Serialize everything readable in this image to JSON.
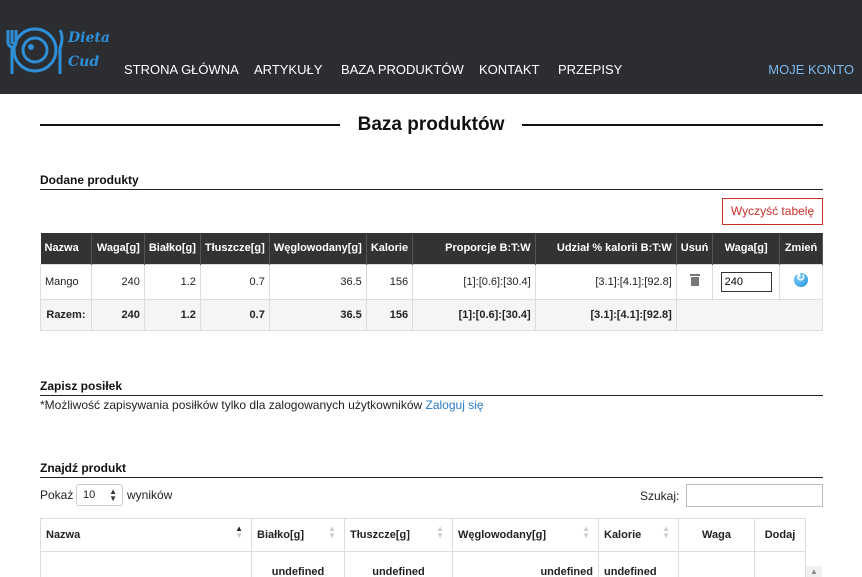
{
  "brand": {
    "line1": "Dieta",
    "line2": "Cud"
  },
  "nav": {
    "items": [
      "STRONA GŁÓWNA",
      "ARTYKUŁY",
      "BAZA PRODUKTÓW",
      "KONTAKT",
      "PRZEPISY"
    ],
    "account": "MOJE KONTO"
  },
  "page_title": "Baza produktów",
  "added": {
    "heading": "Dodane produkty",
    "clear_button": "Wyczyść tabelę",
    "columns": [
      "Nazwa",
      "Waga[g]",
      "Białko[g]",
      "Tłuszcze[g]",
      "Węglowodany[g]",
      "Kalorie",
      "Proporcje B:T:W",
      "Udział % kalorii B:T:W",
      "Usuń",
      "Waga[g]",
      "Zmień"
    ],
    "row": {
      "name": "Mango",
      "weight": "240",
      "protein": "1.2",
      "fat": "0.7",
      "carbs": "36.5",
      "kcal": "156",
      "ratio": "[1]:[0.6]:[30.4]",
      "share": "[3.1]:[4.1]:[92.8]",
      "weight_input": "240"
    },
    "total": {
      "label": "Razem:",
      "weight": "240",
      "protein": "1.2",
      "fat": "0.7",
      "carbs": "36.5",
      "kcal": "156",
      "ratio": "[1]:[0.6]:[30.4]",
      "share": "[3.1]:[4.1]:[92.8]"
    }
  },
  "save": {
    "heading": "Zapisz posiłek",
    "info": "*Możliwość zapisywania posiłków tylko dla zalogowanych użytkowników ",
    "login_link": "Zaloguj się"
  },
  "find": {
    "heading": "Znajdź produkt",
    "show_label": "Pokaż",
    "page_size": "10",
    "results_label": "wyników",
    "search_label": "Szukaj:",
    "search_value": "",
    "columns": [
      "Nazwa",
      "Białko[g]",
      "Tłuszcze[g]",
      "Węglowodany[g]",
      "Kalorie",
      "Waga",
      "Dodaj"
    ],
    "first_row": [
      "",
      "undefined",
      "undefined",
      "undefined",
      "undefined",
      "",
      ""
    ]
  }
}
